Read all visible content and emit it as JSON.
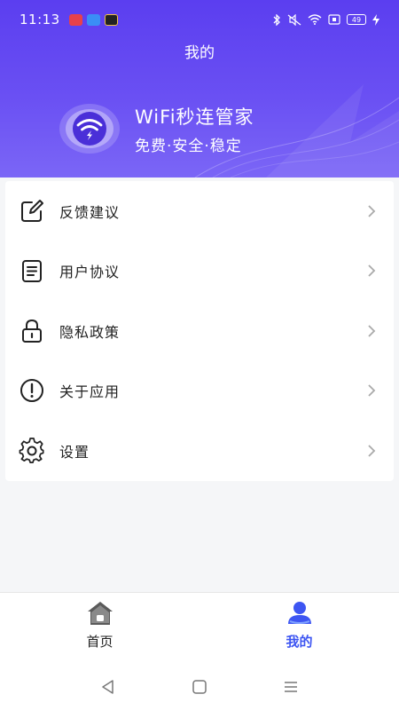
{
  "status_bar": {
    "time": "11:13",
    "battery": "49",
    "app_colors": [
      "#e8414a",
      "#3a8ef6",
      "#222222"
    ]
  },
  "header": {
    "title": "我的",
    "brand_name": "WiFi秒连管家",
    "slogan": "免费·安全·稳定"
  },
  "menu": {
    "items": [
      {
        "label": "反馈建议",
        "icon": "edit-icon"
      },
      {
        "label": "用户协议",
        "icon": "document-icon"
      },
      {
        "label": "隐私政策",
        "icon": "lock-icon"
      },
      {
        "label": "关于应用",
        "icon": "info-icon"
      },
      {
        "label": "设置",
        "icon": "gear-icon"
      }
    ]
  },
  "tabs": {
    "home": {
      "label": "首页",
      "icon": "home-icon"
    },
    "mine": {
      "label": "我的",
      "icon": "user-icon",
      "active": true
    }
  },
  "colors": {
    "header": "#5b3ef0",
    "accent": "#3d55f2"
  }
}
